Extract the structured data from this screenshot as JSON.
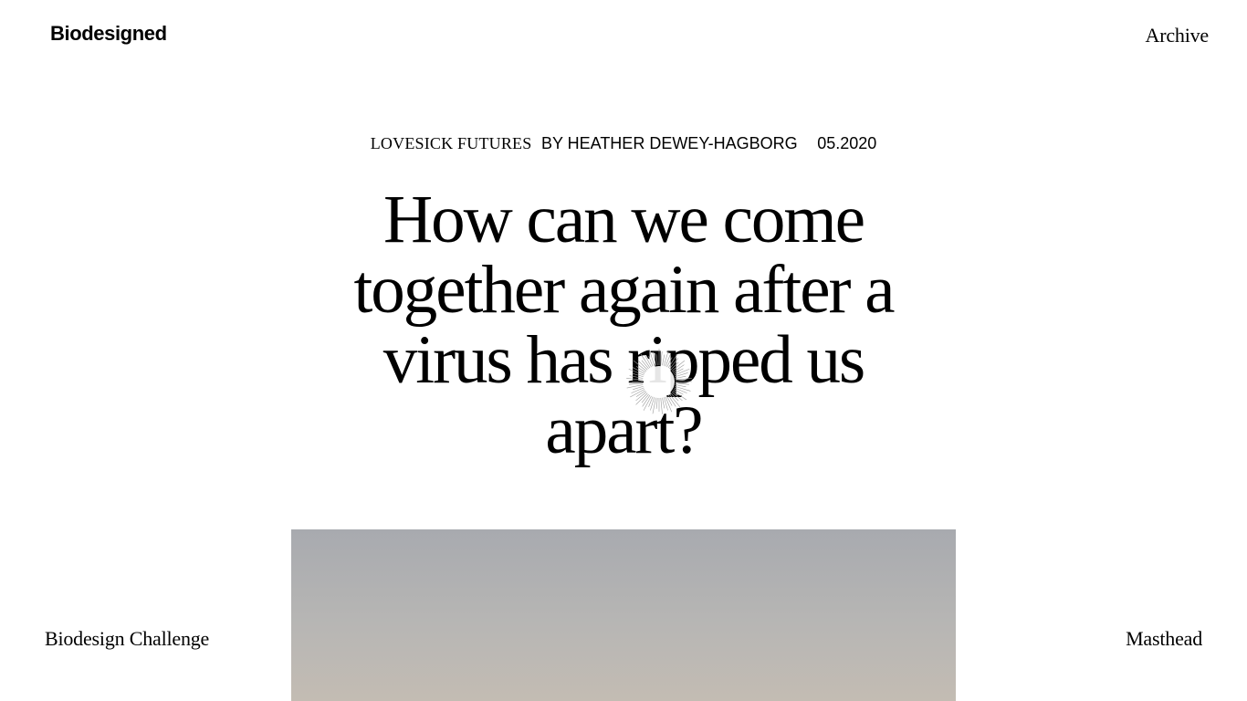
{
  "header": {
    "logo": "Biodesigned",
    "archive_link": "Archive"
  },
  "article": {
    "series": "Lovesick Futures",
    "byline": "By Heather Dewey-Hagborg",
    "date": "05.2020",
    "title": "How can we come together again after a virus has ripped us apart?"
  },
  "footer_nav": {
    "left_link": "Biodesign Challenge",
    "right_link": "Masthead"
  },
  "icons": {
    "loader": "spinner-icon"
  }
}
